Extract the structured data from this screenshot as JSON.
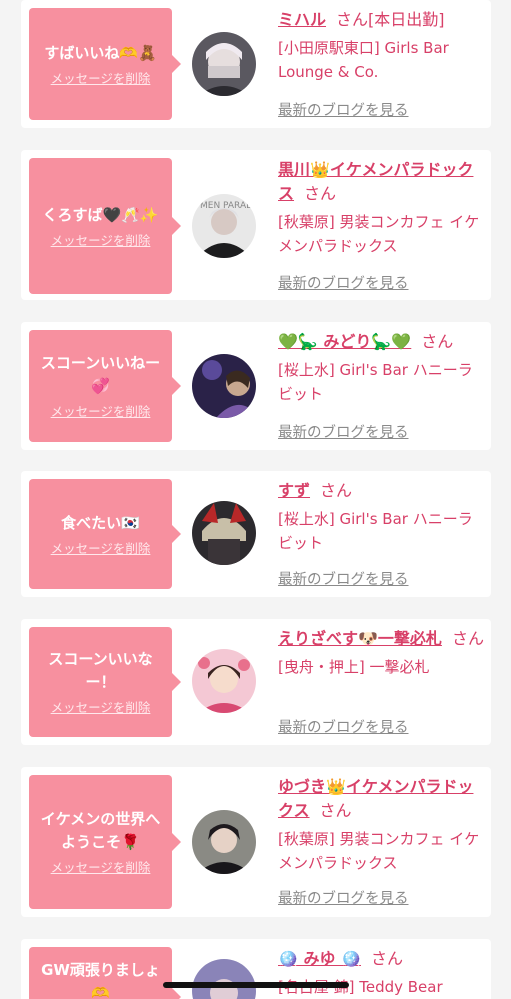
{
  "delete_label": "メッセージを削除",
  "blog_label": "最新のブログを見る",
  "san_label": "さん",
  "colors": {
    "accent": "#d84068",
    "bubble": "#f7909f",
    "background": "#f4f4f4"
  },
  "cards": [
    {
      "message": "すばいいね🫶🧸",
      "name": "ミハル",
      "tag": "[本日出勤]",
      "shop": "[小田原駅東口] Girls Bar Lounge & Co."
    },
    {
      "message": "くろすば🖤🥂✨",
      "name": "黒川👑イケメンパラドックス",
      "tag": "",
      "shop": "[秋葉原] 男装コンカフェ イケメンパラドックス"
    },
    {
      "message": "スコーンいいねー💞",
      "name": "💚🦕 みどり🦕💚",
      "tag": "",
      "shop": "[桜上水] Girl's Bar ハニーラビット"
    },
    {
      "message": "食べたい🇰🇷",
      "name": "すず",
      "tag": "",
      "shop": "[桜上水] Girl's Bar ハニーラビット"
    },
    {
      "message": "スコーンいいなー！",
      "name": "えりざべす🐶一撃必札",
      "tag": "",
      "shop": "[曳舟・押上] 一撃必札"
    },
    {
      "message": "イケメンの世界へようこそ🌹",
      "name": "ゆづき👑イケメンパラドックス",
      "tag": "",
      "shop": "[秋葉原] 男装コンカフェ イケメンパラドックス"
    },
    {
      "message": "GW頑張りましょ🫶",
      "name": "🪩 みゆ 🪩",
      "tag": "",
      "shop": "[名古屋 錦] Teddy Bear"
    }
  ]
}
